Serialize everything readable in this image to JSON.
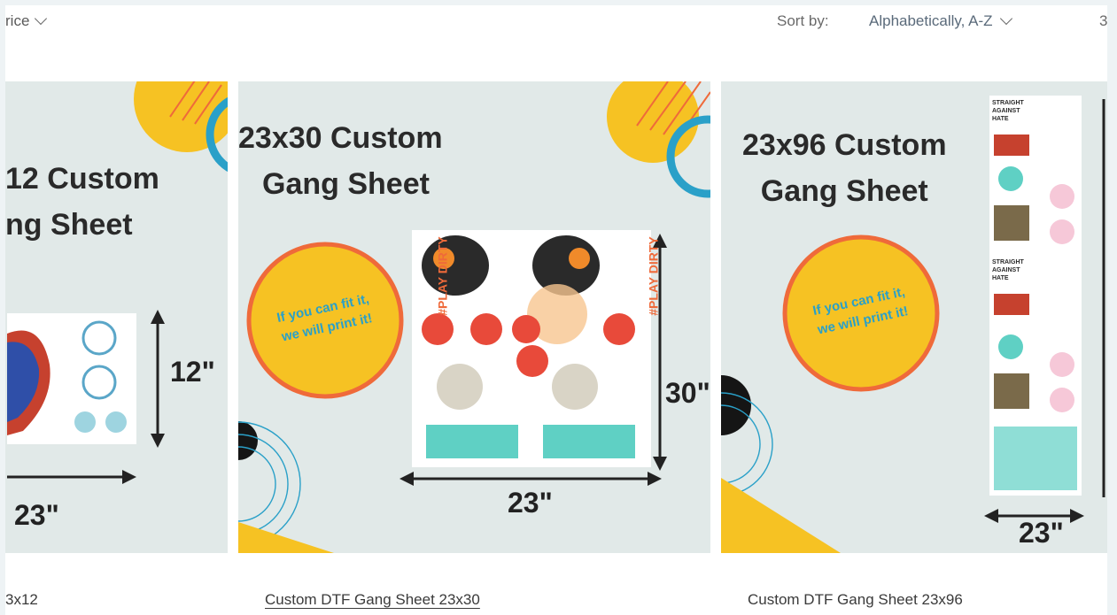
{
  "toolbar": {
    "filter_label": "rice",
    "sort_label": "Sort by:",
    "sort_value": "Alphabetically, A-Z",
    "count_partial": "3"
  },
  "products": [
    {
      "image_title_line1": "12 Custom",
      "image_title_line2": "ng Sheet",
      "height_label": "12\"",
      "width_label": "23\"",
      "name": "3x12"
    },
    {
      "image_title_line1": "23x30 Custom",
      "image_title_line2": "Gang Sheet",
      "slogan_line1": "If you can fit it,",
      "slogan_line2": "we will print it!",
      "height_label": "30\"",
      "width_label": "23\"",
      "side_text": "#PLAY DIRTY",
      "name": "Custom DTF Gang Sheet 23x30"
    },
    {
      "image_title_line1": "23x96 Custom",
      "image_title_line2": "Gang Sheet",
      "slogan_line1": "If you can fit it,",
      "slogan_line2": "we will print it!",
      "width_label": "23\"",
      "sticker_text": "STRAIGHT AGAINST HATE",
      "name": "Custom DTF Gang Sheet 23x96"
    }
  ],
  "colors": {
    "page_background": "#eef3f5",
    "card_background": "#e1e9e8",
    "accent_yellow": "#f6c223",
    "accent_orange": "#ef6a3a",
    "accent_blue": "#2aa0c8",
    "sticker_teal": "#5fd0c4"
  }
}
